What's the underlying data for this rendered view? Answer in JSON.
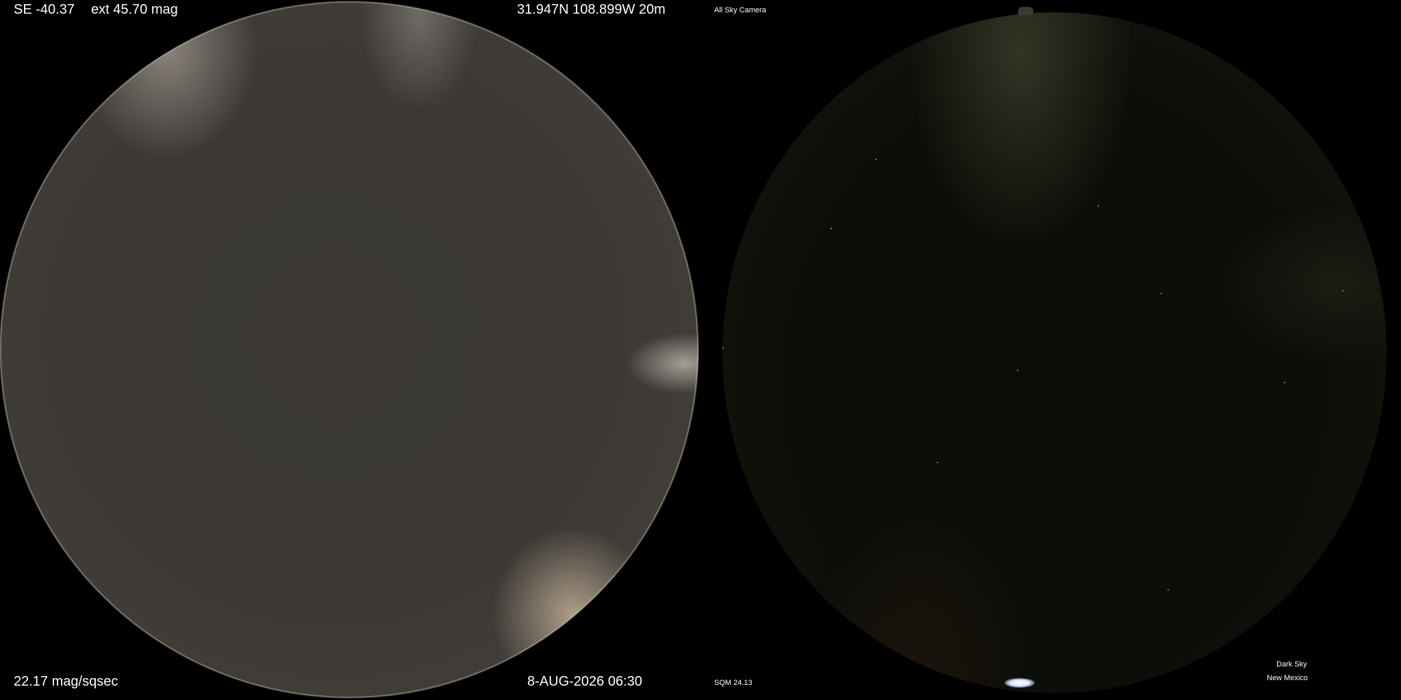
{
  "left_panel": {
    "sun_elevation": "SE -40.37",
    "extinction": "ext 45.70 mag",
    "coordinates": "31.947N 108.899W 20m",
    "sky_brightness": "22.17 mag/sqsec",
    "datetime": "8-AUG-2026 06:30"
  },
  "right_panel": {
    "camera_title": "All Sky Camera",
    "sqm_reading": "SQM 24.13",
    "location_line1": "Dark Sky",
    "location_line2": "New Mexico"
  }
}
